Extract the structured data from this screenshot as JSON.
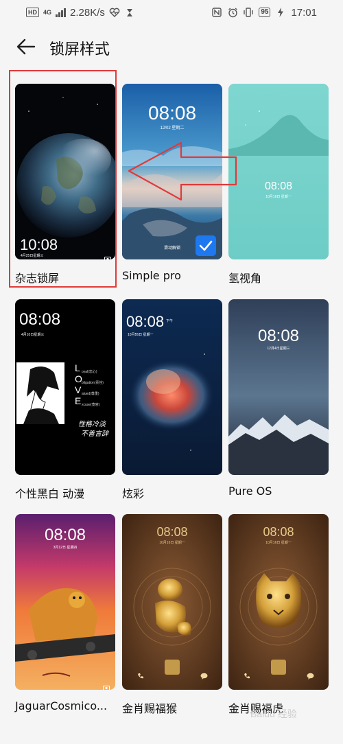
{
  "status_bar": {
    "hd": "HD",
    "net": "4G",
    "speed": "2.28K/s",
    "battery": "95",
    "time": "17:01"
  },
  "header": {
    "back_icon": "arrow-left-icon",
    "title": "锁屏样式"
  },
  "styles": [
    {
      "label": "杂志锁屏",
      "time": "10:08",
      "date": "4月25日星期三",
      "selected_highlight": true
    },
    {
      "label": "Simple pro",
      "time": "08:08",
      "date": "12/02 星期二",
      "hint": "滑动解锁",
      "checked": true
    },
    {
      "label": "氢视角",
      "time": "08:08",
      "date": "10月16日 星期一"
    },
    {
      "label": "个性黑白 动漫",
      "time": "08:08",
      "date": "4月10日星期三",
      "love_letters": [
        "L",
        "O",
        "V",
        "E"
      ],
      "love_words": [
        "oyal(忠心)",
        "bligation(责任)",
        "alued(尊重)",
        "xcuse(宽容)"
      ],
      "calligraphy": [
        "性格冷淡",
        "不善言辞"
      ]
    },
    {
      "label": "炫彩",
      "time": "08:08",
      "ampm": "下午",
      "date": "10月16日 星期一"
    },
    {
      "label": "Pure OS",
      "time": "08:08",
      "date": "12月4日星期三"
    },
    {
      "label": "JaguarCosmico...",
      "time": "08:08",
      "date": "3月12日 星期四"
    },
    {
      "label": "金肖赐福猴",
      "time": "08:08",
      "date": "10月16日 星期一"
    },
    {
      "label": "金肖赐福虎",
      "time": "08:08",
      "date": "10月16日 星期一"
    }
  ],
  "annotations": {
    "arrow": "red-outline-arrow-left",
    "highlight_color": "#e03a3a"
  },
  "watermark": "Baidu 经验",
  "colors": {
    "accent": "#1e78f0",
    "background": "#f5f5f5"
  }
}
